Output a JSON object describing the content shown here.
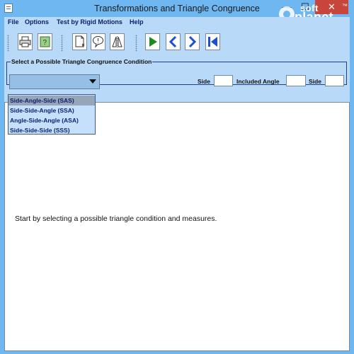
{
  "window": {
    "title": "Transformations and Triangle Congruence",
    "controls": {
      "minimize": "—",
      "maximize": "☐",
      "close": "✕"
    }
  },
  "watermark": {
    "line1": "soft",
    "line2": "planet",
    "tm": "™"
  },
  "menu": [
    {
      "label": "File"
    },
    {
      "label": "Options"
    },
    {
      "label": "Test by Rigid Motions"
    },
    {
      "label": "Help"
    }
  ],
  "toolbar": {
    "buttons": [
      {
        "icon": "print-icon"
      },
      {
        "icon": "help-book-icon"
      },
      {
        "icon": "new-document-icon"
      },
      {
        "icon": "speech-bubble-icon"
      },
      {
        "icon": "triangle-reflect-icon"
      },
      {
        "icon": "play-icon"
      },
      {
        "icon": "previous-icon"
      },
      {
        "icon": "next-icon"
      },
      {
        "icon": "first-icon"
      }
    ]
  },
  "condition_panel": {
    "legend": "Select a Possible Triangle Congruence Condition",
    "combo_value": "",
    "fields": [
      {
        "label": "Side",
        "value": ""
      },
      {
        "label": "Included Angle",
        "value": ""
      },
      {
        "label": "Side",
        "value": ""
      }
    ]
  },
  "dropdown": {
    "options": [
      "Side-Angle-Side (SAS)",
      "Side-Side-Angle (SSA)",
      "Angle-Side-Angle (ASA)",
      "Side-Side-Side (SSS)"
    ],
    "highlighted_index": 0
  },
  "canvas": {
    "message": "Start by selecting a possible triangle condition and measures."
  },
  "colors": {
    "window_frame": "#6fb7f0",
    "panel": "#b8d9f8",
    "close_button": "#c7453a",
    "play_green": "#1e8a1e",
    "nav_blue": "#1c4fd1"
  }
}
